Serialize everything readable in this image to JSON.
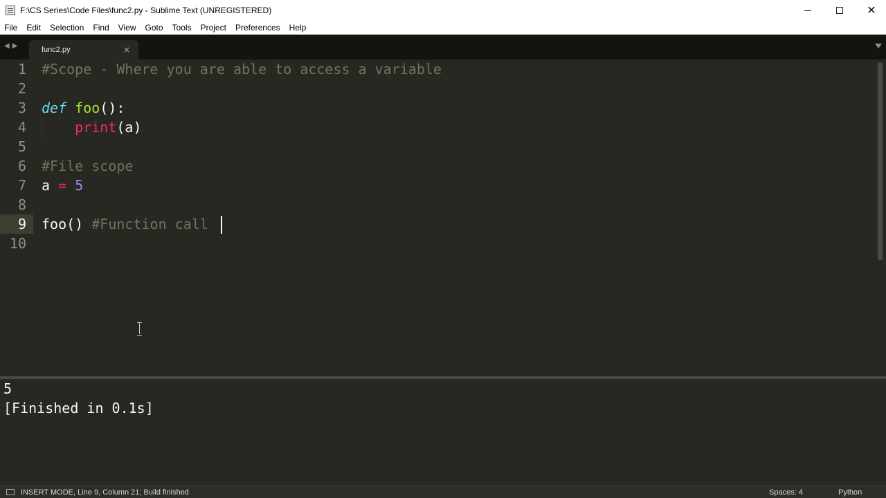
{
  "window": {
    "title": "F:\\CS Series\\Code Files\\func2.py - Sublime Text (UNREGISTERED)",
    "minimize_glyph": "minimize-icon",
    "maximize_glyph": "maximize-icon",
    "close_glyph": "✕"
  },
  "menu": [
    "File",
    "Edit",
    "Selection",
    "Find",
    "View",
    "Goto",
    "Tools",
    "Project",
    "Preferences",
    "Help"
  ],
  "tabs": [
    {
      "label": "func2.py",
      "close": "×",
      "active": true
    }
  ],
  "nav": {
    "back": "◀",
    "forward": "▶"
  },
  "editor": {
    "line_numbers": [
      "1",
      "2",
      "3",
      "4",
      "5",
      "6",
      "7",
      "8",
      "9",
      "10"
    ],
    "active_line": "9",
    "lines": {
      "l1_comment": "#Scope - Where you are able to access a variable",
      "l3_keyword": "def",
      "l3_fn": "foo",
      "l3_rest": "():",
      "l4_builtin": "print",
      "l4_rest": "(a)",
      "l6_comment": "#File scope",
      "l7_var": "a",
      "l7_op": "=",
      "l7_num": "5",
      "l9_call": "foo()",
      "l9_comment": "#Function call"
    }
  },
  "output": {
    "lines": [
      "5",
      "[Finished in 0.1s]"
    ]
  },
  "status": {
    "left": "INSERT MODE, Line 9, Column 21; Build finished",
    "spaces": "Spaces: 4",
    "syntax": "Python"
  },
  "colors": {
    "background": "#272822",
    "comment": "#75715e",
    "keyword": "#66d9ef",
    "function": "#a6e22e",
    "builtin": "#f92672",
    "number": "#ae81ff"
  }
}
